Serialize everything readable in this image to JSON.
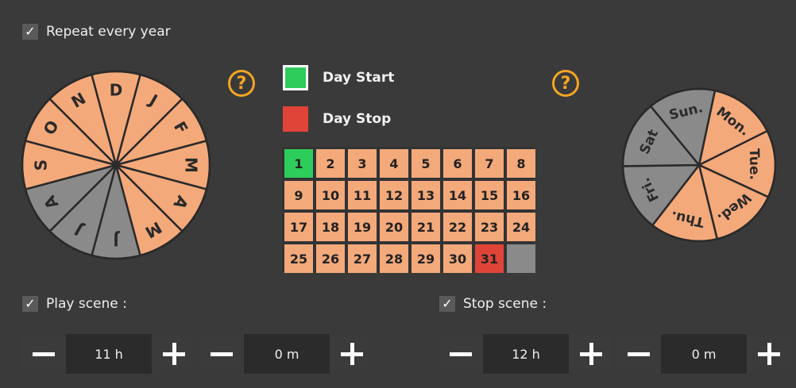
{
  "repeat": {
    "label": "Repeat every year",
    "checked": true
  },
  "months": [
    "J",
    "F",
    "M",
    "A",
    "M",
    "J",
    "J",
    "A",
    "S",
    "O",
    "N",
    "D"
  ],
  "months_active": [
    true,
    true,
    true,
    true,
    true,
    false,
    false,
    false,
    true,
    true,
    true,
    true
  ],
  "weekdays": [
    "Mon.",
    "Tue.",
    "Wed.",
    "Thu.",
    "Fri.",
    "Sat",
    "Sun."
  ],
  "weekdays_active": [
    true,
    true,
    true,
    true,
    false,
    false,
    false
  ],
  "help_icon": "?",
  "legend": {
    "start": "Day Start",
    "stop": "Day Stop"
  },
  "calendar": {
    "days": [
      "1",
      "2",
      "3",
      "4",
      "5",
      "6",
      "7",
      "8",
      "9",
      "10",
      "11",
      "12",
      "13",
      "14",
      "15",
      "16",
      "17",
      "18",
      "19",
      "20",
      "21",
      "22",
      "23",
      "24",
      "25",
      "26",
      "27",
      "28",
      "29",
      "30",
      "31",
      ""
    ],
    "start_index": 0,
    "stop_index": 30
  },
  "play": {
    "label": "Play scene :",
    "checked": true,
    "hours": "11 h",
    "minutes": "0 m"
  },
  "stop": {
    "label": "Stop scene :",
    "checked": true,
    "hours": "12 h",
    "minutes": "0 m"
  },
  "colors": {
    "active": "#f4a97a",
    "inactive": "#8a8a8a",
    "start": "#2ecc5a",
    "stop": "#e04438",
    "accent": "#f5a623"
  }
}
